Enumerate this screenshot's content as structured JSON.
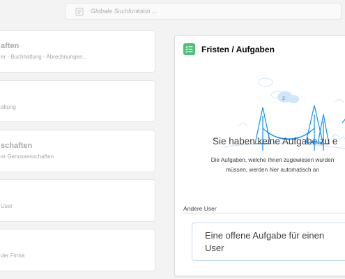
{
  "search": {
    "placeholder": "Globale Suchfunktion ..."
  },
  "left_cards": [
    {
      "title": "aften",
      "subtitle": "er - Buchhaltung - Abrechnungen..."
    },
    {
      "title": "",
      "subtitle": "altung"
    },
    {
      "title": "schaften",
      "subtitle": "er Genossenschaften"
    },
    {
      "title": "",
      "subtitle": "User"
    },
    {
      "title": "",
      "subtitle": "der Firma"
    }
  ],
  "tasks_panel": {
    "title": "Fristen / Aufgaben",
    "empty_title": "Sie haben keine Aufgabe zu e",
    "empty_desc_line1": "Die Aufgaben, welche Ihnen zugewiesen wurden",
    "empty_desc_line2": "müssen, werden hier automatisch an",
    "other_label": "Andere User",
    "other_line1": "Eine offene Aufgabe für einen",
    "other_line2": "User"
  },
  "colors": {
    "accent_green": "#4bc076",
    "illustration_blue": "#1b96ff",
    "illustration_light": "#cfe6fb"
  }
}
